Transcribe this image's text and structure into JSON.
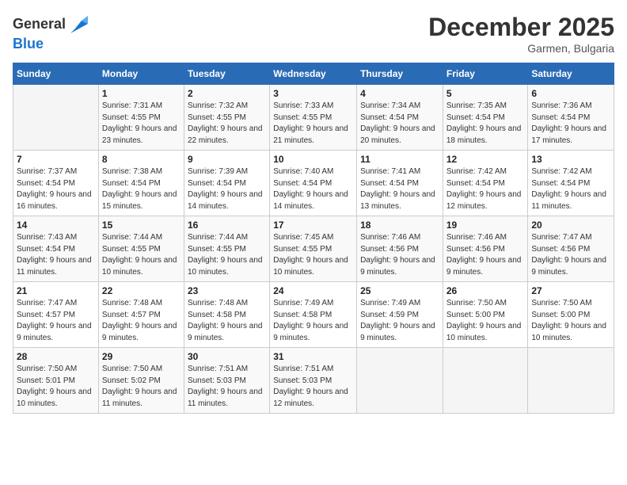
{
  "header": {
    "logo_general": "General",
    "logo_blue": "Blue",
    "month": "December 2025",
    "location": "Garmen, Bulgaria"
  },
  "days_of_week": [
    "Sunday",
    "Monday",
    "Tuesday",
    "Wednesday",
    "Thursday",
    "Friday",
    "Saturday"
  ],
  "weeks": [
    [
      {
        "num": "",
        "sunrise": "",
        "sunset": "",
        "daylight": "",
        "empty": true
      },
      {
        "num": "1",
        "sunrise": "Sunrise: 7:31 AM",
        "sunset": "Sunset: 4:55 PM",
        "daylight": "Daylight: 9 hours and 23 minutes."
      },
      {
        "num": "2",
        "sunrise": "Sunrise: 7:32 AM",
        "sunset": "Sunset: 4:55 PM",
        "daylight": "Daylight: 9 hours and 22 minutes."
      },
      {
        "num": "3",
        "sunrise": "Sunrise: 7:33 AM",
        "sunset": "Sunset: 4:55 PM",
        "daylight": "Daylight: 9 hours and 21 minutes."
      },
      {
        "num": "4",
        "sunrise": "Sunrise: 7:34 AM",
        "sunset": "Sunset: 4:54 PM",
        "daylight": "Daylight: 9 hours and 20 minutes."
      },
      {
        "num": "5",
        "sunrise": "Sunrise: 7:35 AM",
        "sunset": "Sunset: 4:54 PM",
        "daylight": "Daylight: 9 hours and 18 minutes."
      },
      {
        "num": "6",
        "sunrise": "Sunrise: 7:36 AM",
        "sunset": "Sunset: 4:54 PM",
        "daylight": "Daylight: 9 hours and 17 minutes."
      }
    ],
    [
      {
        "num": "7",
        "sunrise": "Sunrise: 7:37 AM",
        "sunset": "Sunset: 4:54 PM",
        "daylight": "Daylight: 9 hours and 16 minutes."
      },
      {
        "num": "8",
        "sunrise": "Sunrise: 7:38 AM",
        "sunset": "Sunset: 4:54 PM",
        "daylight": "Daylight: 9 hours and 15 minutes."
      },
      {
        "num": "9",
        "sunrise": "Sunrise: 7:39 AM",
        "sunset": "Sunset: 4:54 PM",
        "daylight": "Daylight: 9 hours and 14 minutes."
      },
      {
        "num": "10",
        "sunrise": "Sunrise: 7:40 AM",
        "sunset": "Sunset: 4:54 PM",
        "daylight": "Daylight: 9 hours and 14 minutes."
      },
      {
        "num": "11",
        "sunrise": "Sunrise: 7:41 AM",
        "sunset": "Sunset: 4:54 PM",
        "daylight": "Daylight: 9 hours and 13 minutes."
      },
      {
        "num": "12",
        "sunrise": "Sunrise: 7:42 AM",
        "sunset": "Sunset: 4:54 PM",
        "daylight": "Daylight: 9 hours and 12 minutes."
      },
      {
        "num": "13",
        "sunrise": "Sunrise: 7:42 AM",
        "sunset": "Sunset: 4:54 PM",
        "daylight": "Daylight: 9 hours and 11 minutes."
      }
    ],
    [
      {
        "num": "14",
        "sunrise": "Sunrise: 7:43 AM",
        "sunset": "Sunset: 4:54 PM",
        "daylight": "Daylight: 9 hours and 11 minutes."
      },
      {
        "num": "15",
        "sunrise": "Sunrise: 7:44 AM",
        "sunset": "Sunset: 4:55 PM",
        "daylight": "Daylight: 9 hours and 10 minutes."
      },
      {
        "num": "16",
        "sunrise": "Sunrise: 7:44 AM",
        "sunset": "Sunset: 4:55 PM",
        "daylight": "Daylight: 9 hours and 10 minutes."
      },
      {
        "num": "17",
        "sunrise": "Sunrise: 7:45 AM",
        "sunset": "Sunset: 4:55 PM",
        "daylight": "Daylight: 9 hours and 10 minutes."
      },
      {
        "num": "18",
        "sunrise": "Sunrise: 7:46 AM",
        "sunset": "Sunset: 4:56 PM",
        "daylight": "Daylight: 9 hours and 9 minutes."
      },
      {
        "num": "19",
        "sunrise": "Sunrise: 7:46 AM",
        "sunset": "Sunset: 4:56 PM",
        "daylight": "Daylight: 9 hours and 9 minutes."
      },
      {
        "num": "20",
        "sunrise": "Sunrise: 7:47 AM",
        "sunset": "Sunset: 4:56 PM",
        "daylight": "Daylight: 9 hours and 9 minutes."
      }
    ],
    [
      {
        "num": "21",
        "sunrise": "Sunrise: 7:47 AM",
        "sunset": "Sunset: 4:57 PM",
        "daylight": "Daylight: 9 hours and 9 minutes."
      },
      {
        "num": "22",
        "sunrise": "Sunrise: 7:48 AM",
        "sunset": "Sunset: 4:57 PM",
        "daylight": "Daylight: 9 hours and 9 minutes."
      },
      {
        "num": "23",
        "sunrise": "Sunrise: 7:48 AM",
        "sunset": "Sunset: 4:58 PM",
        "daylight": "Daylight: 9 hours and 9 minutes."
      },
      {
        "num": "24",
        "sunrise": "Sunrise: 7:49 AM",
        "sunset": "Sunset: 4:58 PM",
        "daylight": "Daylight: 9 hours and 9 minutes."
      },
      {
        "num": "25",
        "sunrise": "Sunrise: 7:49 AM",
        "sunset": "Sunset: 4:59 PM",
        "daylight": "Daylight: 9 hours and 9 minutes."
      },
      {
        "num": "26",
        "sunrise": "Sunrise: 7:50 AM",
        "sunset": "Sunset: 5:00 PM",
        "daylight": "Daylight: 9 hours and 10 minutes."
      },
      {
        "num": "27",
        "sunrise": "Sunrise: 7:50 AM",
        "sunset": "Sunset: 5:00 PM",
        "daylight": "Daylight: 9 hours and 10 minutes."
      }
    ],
    [
      {
        "num": "28",
        "sunrise": "Sunrise: 7:50 AM",
        "sunset": "Sunset: 5:01 PM",
        "daylight": "Daylight: 9 hours and 10 minutes."
      },
      {
        "num": "29",
        "sunrise": "Sunrise: 7:50 AM",
        "sunset": "Sunset: 5:02 PM",
        "daylight": "Daylight: 9 hours and 11 minutes."
      },
      {
        "num": "30",
        "sunrise": "Sunrise: 7:51 AM",
        "sunset": "Sunset: 5:03 PM",
        "daylight": "Daylight: 9 hours and 11 minutes."
      },
      {
        "num": "31",
        "sunrise": "Sunrise: 7:51 AM",
        "sunset": "Sunset: 5:03 PM",
        "daylight": "Daylight: 9 hours and 12 minutes."
      },
      {
        "num": "",
        "sunrise": "",
        "sunset": "",
        "daylight": "",
        "empty": true
      },
      {
        "num": "",
        "sunrise": "",
        "sunset": "",
        "daylight": "",
        "empty": true
      },
      {
        "num": "",
        "sunrise": "",
        "sunset": "",
        "daylight": "",
        "empty": true
      }
    ]
  ]
}
